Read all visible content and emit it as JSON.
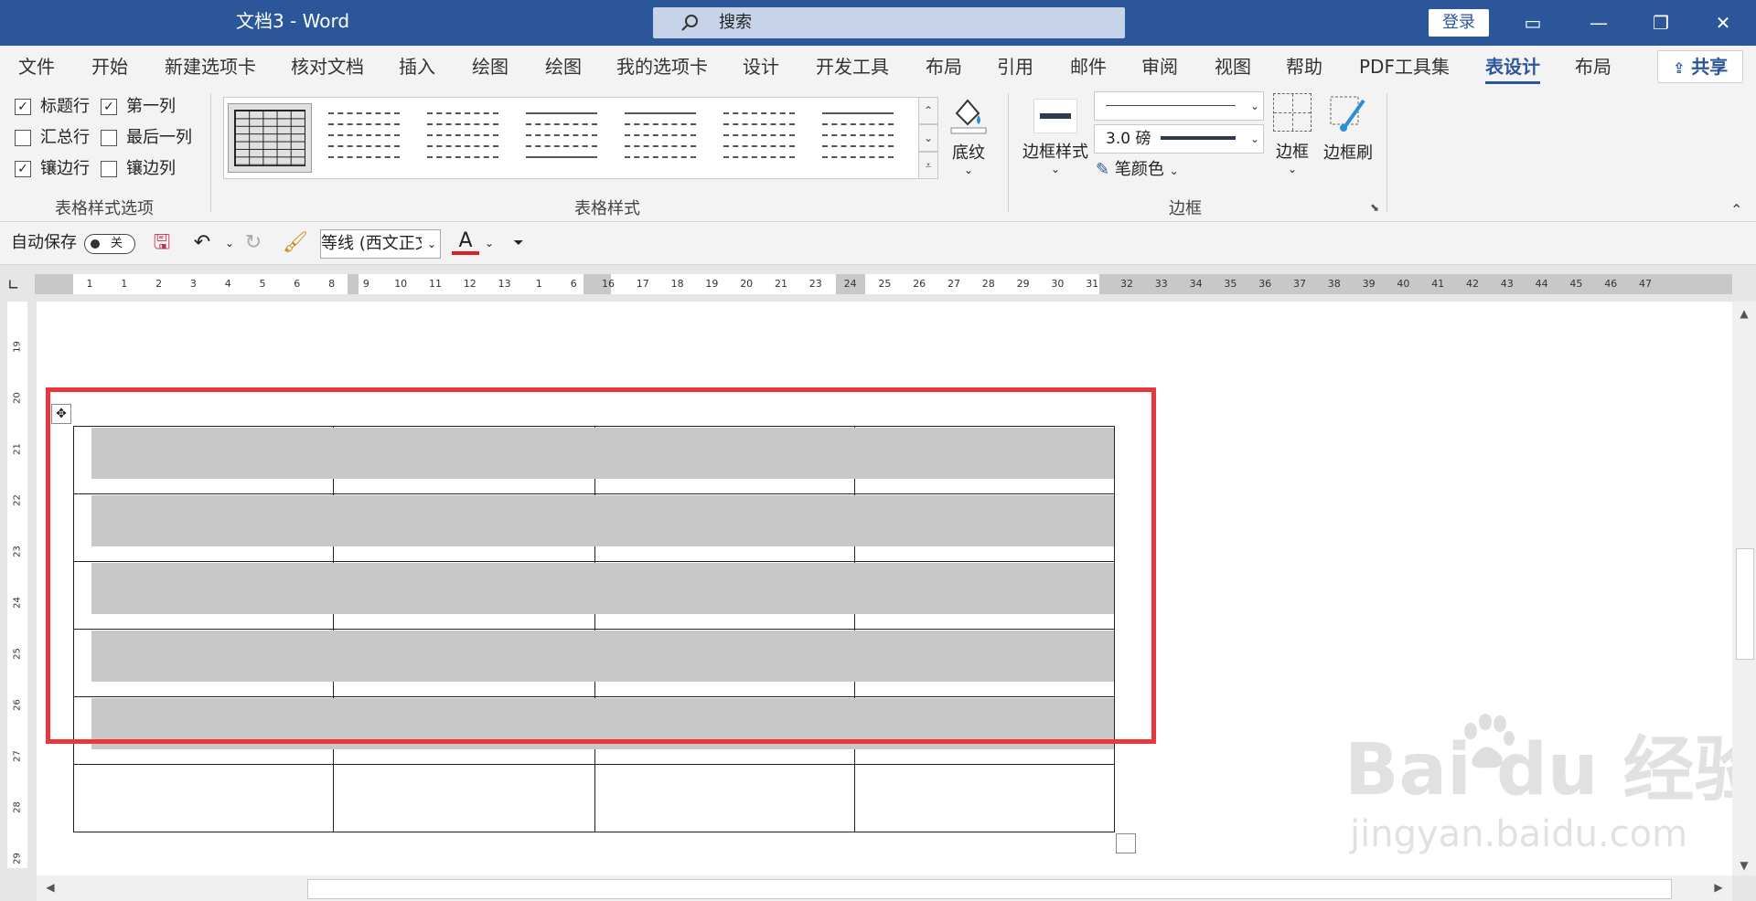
{
  "window": {
    "title": "文档3  -  Word",
    "search_placeholder": "搜索",
    "login_label": "登录",
    "controls": [
      "▭",
      "—",
      "❐",
      "✕"
    ]
  },
  "ribbon_tabs": [
    {
      "label": "文件"
    },
    {
      "label": "开始"
    },
    {
      "label": "新建选项卡"
    },
    {
      "label": "核对文档"
    },
    {
      "label": "插入"
    },
    {
      "label": "绘图"
    },
    {
      "label": "绘图"
    },
    {
      "label": "我的选项卡"
    },
    {
      "label": "设计"
    },
    {
      "label": "开发工具"
    },
    {
      "label": "布局"
    },
    {
      "label": "引用"
    },
    {
      "label": "邮件"
    },
    {
      "label": "审阅"
    },
    {
      "label": "视图"
    },
    {
      "label": "帮助"
    },
    {
      "label": "PDF工具集"
    },
    {
      "label": "表设计",
      "active": true
    },
    {
      "label": "布局"
    }
  ],
  "share_label": "共享",
  "table_style_options": {
    "group_label": "表格样式选项",
    "items": [
      {
        "label": "标题行",
        "checked": true
      },
      {
        "label": "第一列",
        "checked": true
      },
      {
        "label": "汇总行",
        "checked": false
      },
      {
        "label": "最后一列",
        "checked": false
      },
      {
        "label": "镶边行",
        "checked": true
      },
      {
        "label": "镶边列",
        "checked": false
      }
    ]
  },
  "table_styles": {
    "group_label": "表格样式",
    "shading_label": "底纹"
  },
  "borders": {
    "group_label": "边框",
    "border_styles_label": "边框样式",
    "weight": "3.0 磅",
    "pen_color_label": "笔颜色",
    "borders_label": "边框",
    "border_painter_label": "边框刷"
  },
  "qat": {
    "autosave_label": "自动保存",
    "autosave_state": "关",
    "font_name": "等线 (西文正文"
  },
  "ruler": {
    "h_numbers": [
      "1",
      "1",
      "2",
      "3",
      "4",
      "5",
      "6",
      "8",
      "9",
      "10",
      "11",
      "12",
      "13",
      "1",
      "6",
      "16",
      "17",
      "18",
      "19",
      "20",
      "21",
      "23",
      "24",
      "25",
      "26",
      "27",
      "28",
      "29",
      "30",
      "31",
      "32",
      "33",
      "34",
      "35",
      "36",
      "37",
      "38",
      "39",
      "40",
      "41",
      "42",
      "43",
      "44",
      "45",
      "46",
      "47"
    ],
    "v_numbers": [
      "19",
      "20",
      "21",
      "22",
      "23",
      "24",
      "25",
      "26",
      "27",
      "28",
      "29"
    ]
  },
  "watermark": {
    "logo": "Bai  du 经验",
    "url": "jingyan.baidu.com"
  },
  "colors": {
    "title_bar": "#2b579a",
    "highlight": "#e8383d",
    "banded_row": "#c8c8c8"
  },
  "table_layout": {
    "rows": 6,
    "cols": 4,
    "shaded_rows": 5
  }
}
